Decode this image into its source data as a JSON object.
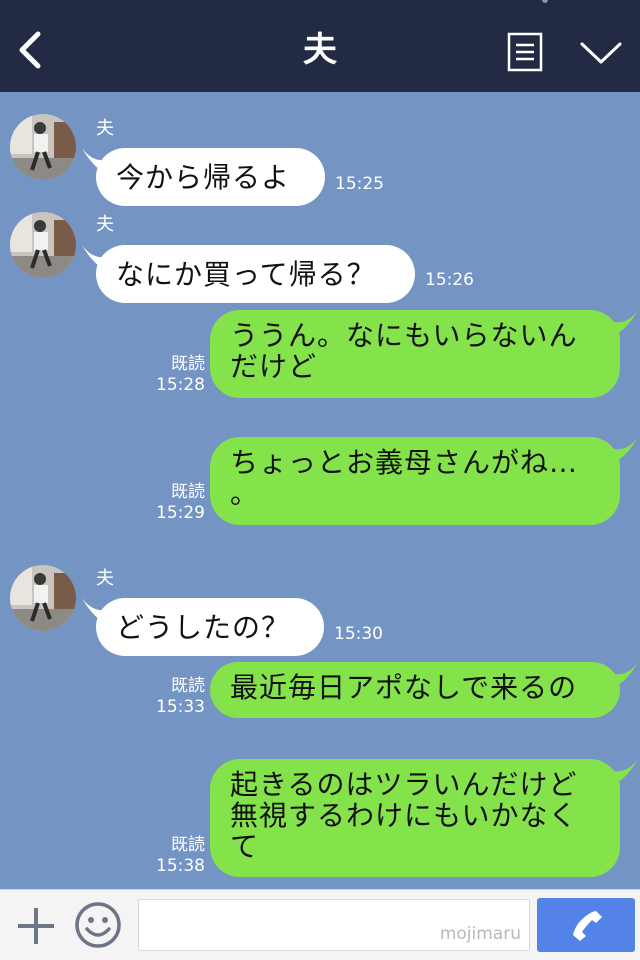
{
  "header": {
    "title": "夫"
  },
  "chat": {
    "messages": [
      {
        "direction": "in",
        "sender": "夫",
        "text": "今から帰るよ",
        "time": "15:25"
      },
      {
        "direction": "in",
        "sender": "夫",
        "text": "なにか買って帰る？",
        "time": "15:26"
      },
      {
        "direction": "out",
        "read": "既読",
        "time": "15:28",
        "lines": [
          "ううん。なにもいらないん",
          "だけど"
        ]
      },
      {
        "direction": "out",
        "read": "既読",
        "time": "15:29",
        "lines": [
          "ちょっとお義母さんがね…",
          "。"
        ]
      },
      {
        "direction": "in",
        "sender": "夫",
        "text": "どうしたの？",
        "time": "15:30"
      },
      {
        "direction": "out",
        "read": "既読",
        "time": "15:33",
        "lines": [
          "最近毎日アポなしで来るの"
        ]
      },
      {
        "direction": "out",
        "read": "既読",
        "time": "15:38",
        "lines": [
          "起きるのはツラいんだけど",
          "無視するわけにもいかなく",
          "て"
        ]
      }
    ]
  },
  "footer": {
    "watermark": "mojimaru"
  },
  "colors": {
    "header_bg": "#232b44",
    "chat_bg": "#7494c3",
    "outgoing_bubble": "#84e34b",
    "incoming_bubble": "#ffffff",
    "send_button": "#5383e6"
  }
}
